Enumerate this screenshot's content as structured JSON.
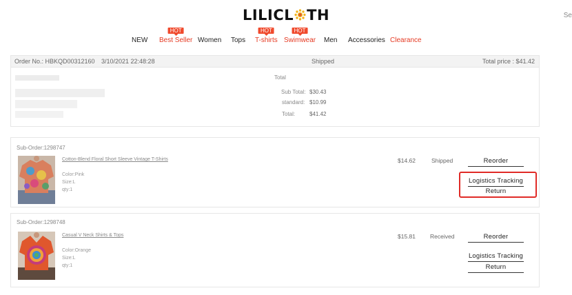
{
  "header": {
    "logo_left": "LILICL",
    "logo_right": "TH",
    "search_edge": "Se"
  },
  "nav": {
    "items": [
      {
        "label": "NEW",
        "hot": false,
        "red": false
      },
      {
        "label": "Best Seller",
        "hot": true,
        "red": true
      },
      {
        "label": "Women",
        "hot": false,
        "red": false
      },
      {
        "label": "Tops",
        "hot": false,
        "red": false
      },
      {
        "label": "T-shirts",
        "hot": true,
        "red": true
      },
      {
        "label": "Swimwear",
        "hot": true,
        "red": true
      },
      {
        "label": "Men",
        "hot": false,
        "red": false
      },
      {
        "label": "Accessories",
        "hot": false,
        "red": false
      },
      {
        "label": "Clearance",
        "hot": false,
        "red": true
      }
    ],
    "hot_label": "HOT"
  },
  "order": {
    "number_text": "Order No.: HBKQD00312160",
    "datetime": "3/10/2021 22:48:28",
    "status": "Shipped",
    "total_text": "Total price : $41.42"
  },
  "summary": {
    "heading": "Total",
    "subtotal_label": "Sub Total:",
    "subtotal_value": "$30.43",
    "shipping_label": "standard:",
    "shipping_value": "$10.99",
    "total_label": "Total:",
    "total_value": "$41.42"
  },
  "sub_orders": [
    {
      "id_text": "Sub-Order:1298747",
      "product_name": "Cotton-Blend Floral Short Sleeve Vintage T-Shirts",
      "color": "Color:Pink",
      "size": "Size:L",
      "qty": "qty:1",
      "price": "$14.62",
      "status": "Shipped",
      "reorder": "Reorder",
      "tracking": "Logistics Tracking",
      "return": "Return"
    },
    {
      "id_text": "Sub-Order:1298748",
      "product_name": "Casual V Neck Shirts & Tops",
      "color": "Color:Orange",
      "size": "Size:L",
      "qty": "qty:1",
      "price": "$15.81",
      "status": "Received",
      "reorder": "Reorder",
      "tracking": "Logistics Tracking",
      "return": "Return"
    }
  ],
  "colors": {
    "accent_red": "#e53922",
    "highlight_box": "#e02a26"
  }
}
